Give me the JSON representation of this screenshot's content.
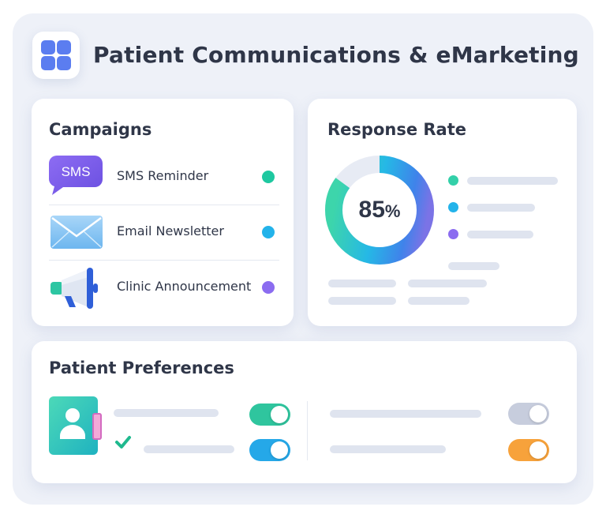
{
  "header": {
    "title": "Patient Communications & eMarketing",
    "icon": "grid-icon",
    "accent": "#5b7df0"
  },
  "campaigns": {
    "title": "Campaigns",
    "items": [
      {
        "label": "SMS Reminder",
        "icon": "sms-bubble-icon",
        "icon_text": "SMS",
        "status_color": "#1ec8a0"
      },
      {
        "label": "Email Newsletter",
        "icon": "envelope-icon",
        "status_color": "#23b3ea"
      },
      {
        "label": "Clinic Announcement",
        "icon": "megaphone-icon",
        "status_color": "#8b6cf0"
      }
    ]
  },
  "response_rate": {
    "title": "Response Rate",
    "value_text": "85",
    "unit": "%"
  },
  "chart_data": {
    "type": "pie",
    "title": "Response Rate",
    "center_label": "85%",
    "values": [
      85,
      15
    ],
    "legend_colors": [
      "#33d0a9",
      "#23b3ea",
      "#8b6cf0"
    ]
  },
  "preferences": {
    "title": "Patient Preferences",
    "toggles": [
      {
        "name": "pref-toggle-1",
        "on": true,
        "color": "#2fc59e"
      },
      {
        "name": "pref-toggle-2",
        "on": true,
        "color": "#25a8e8"
      },
      {
        "name": "pref-toggle-3",
        "on": true,
        "color": "#c7cddd"
      },
      {
        "name": "pref-toggle-4",
        "on": true,
        "color": "#f7a23b"
      }
    ]
  }
}
